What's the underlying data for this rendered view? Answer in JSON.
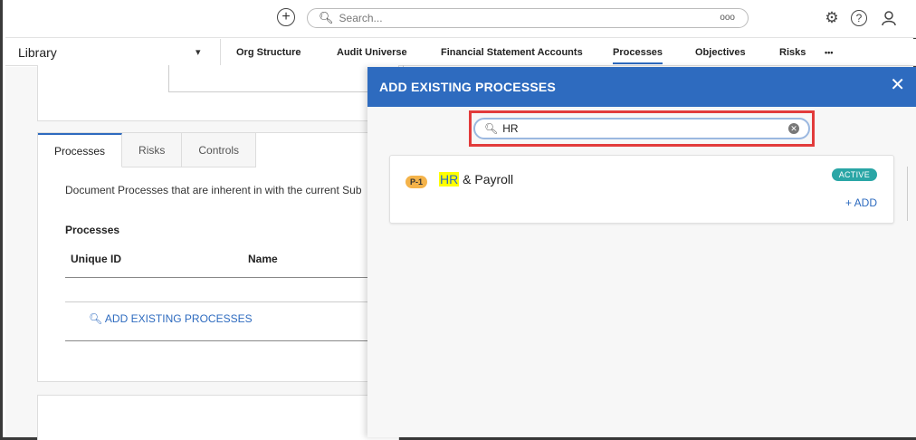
{
  "topbar": {
    "add_icon": "plus-circle",
    "search_placeholder": "Search...",
    "search_more": "ooo",
    "settings_icon": "gear",
    "help_icon": "help",
    "user_icon": "user"
  },
  "nav": {
    "library": "Library",
    "items": [
      "Org Structure",
      "Audit Universe",
      "Financial Statement Accounts",
      "Processes",
      "Objectives",
      "Risks",
      "•••"
    ],
    "active": "Processes"
  },
  "main": {
    "tabs": [
      "Processes",
      "Risks",
      "Controls"
    ],
    "description": "Document Processes that are inherent in with the current Sub",
    "section_title": "Processes",
    "columns": [
      "Unique ID",
      "Name"
    ],
    "add_existing_label": "ADD EXISTING PROCESSES"
  },
  "modal": {
    "title": "ADD EXISTING PROCESSES",
    "close": "✕",
    "search_value": "HR",
    "result": {
      "id": "P-1",
      "name_highlight": "HR",
      "name_rest": " & Payroll",
      "status": "ACTIVE",
      "add_label": "+ ADD"
    }
  },
  "colors": {
    "accent": "#2e6bbf",
    "highlight_box": "#e23b3b",
    "status_badge": "#2aa6a6",
    "id_badge": "#f4b34a"
  }
}
